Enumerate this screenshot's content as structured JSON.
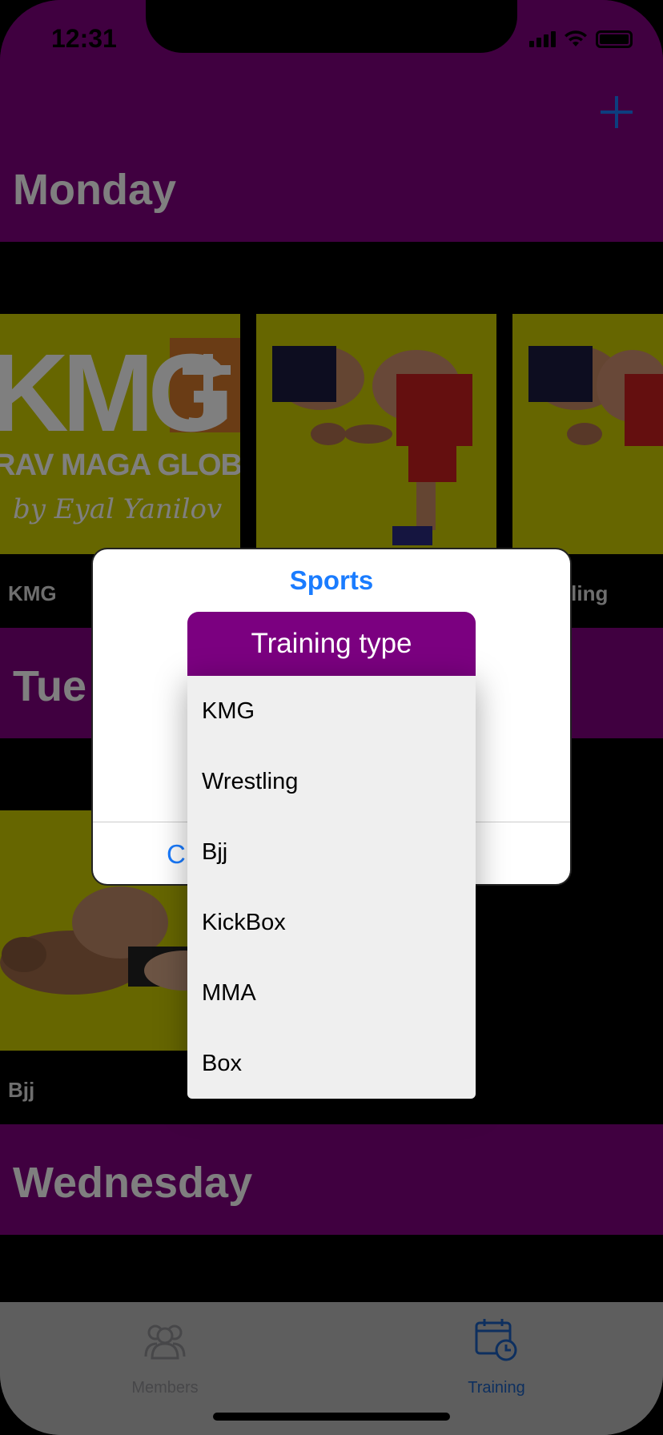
{
  "status_bar": {
    "time": "12:31"
  },
  "days": [
    {
      "name": "Monday",
      "cards": [
        {
          "caption": "KMG"
        },
        {
          "caption": ""
        },
        {
          "caption": "stling"
        }
      ]
    },
    {
      "name": "Tue",
      "cards": [
        {
          "caption": "Bjj"
        }
      ]
    },
    {
      "name": "Wednesday"
    }
  ],
  "kmg_logo": {
    "main": "KMG",
    "sub": "RAV MAGA GLOBA",
    "by": "by  Eyal Yanilov"
  },
  "alert": {
    "title": "Sports",
    "dropdown_label": "Training type",
    "options": [
      "KMG",
      "Wrestling",
      "Bjj",
      "KickBox",
      "MMA",
      "Box"
    ],
    "action_partial": "C"
  },
  "tabs": [
    {
      "label": "Members",
      "icon": "members-icon",
      "color": "#8e8e93"
    },
    {
      "label": "Training",
      "icon": "calendar-clock-icon",
      "color": "#1a5fbf"
    }
  ],
  "colors": {
    "header_purple": "#800080",
    "card_yellow": "#cccc00",
    "accent_blue": "#1a7cff",
    "dropdown_purple": "#7b0080"
  }
}
